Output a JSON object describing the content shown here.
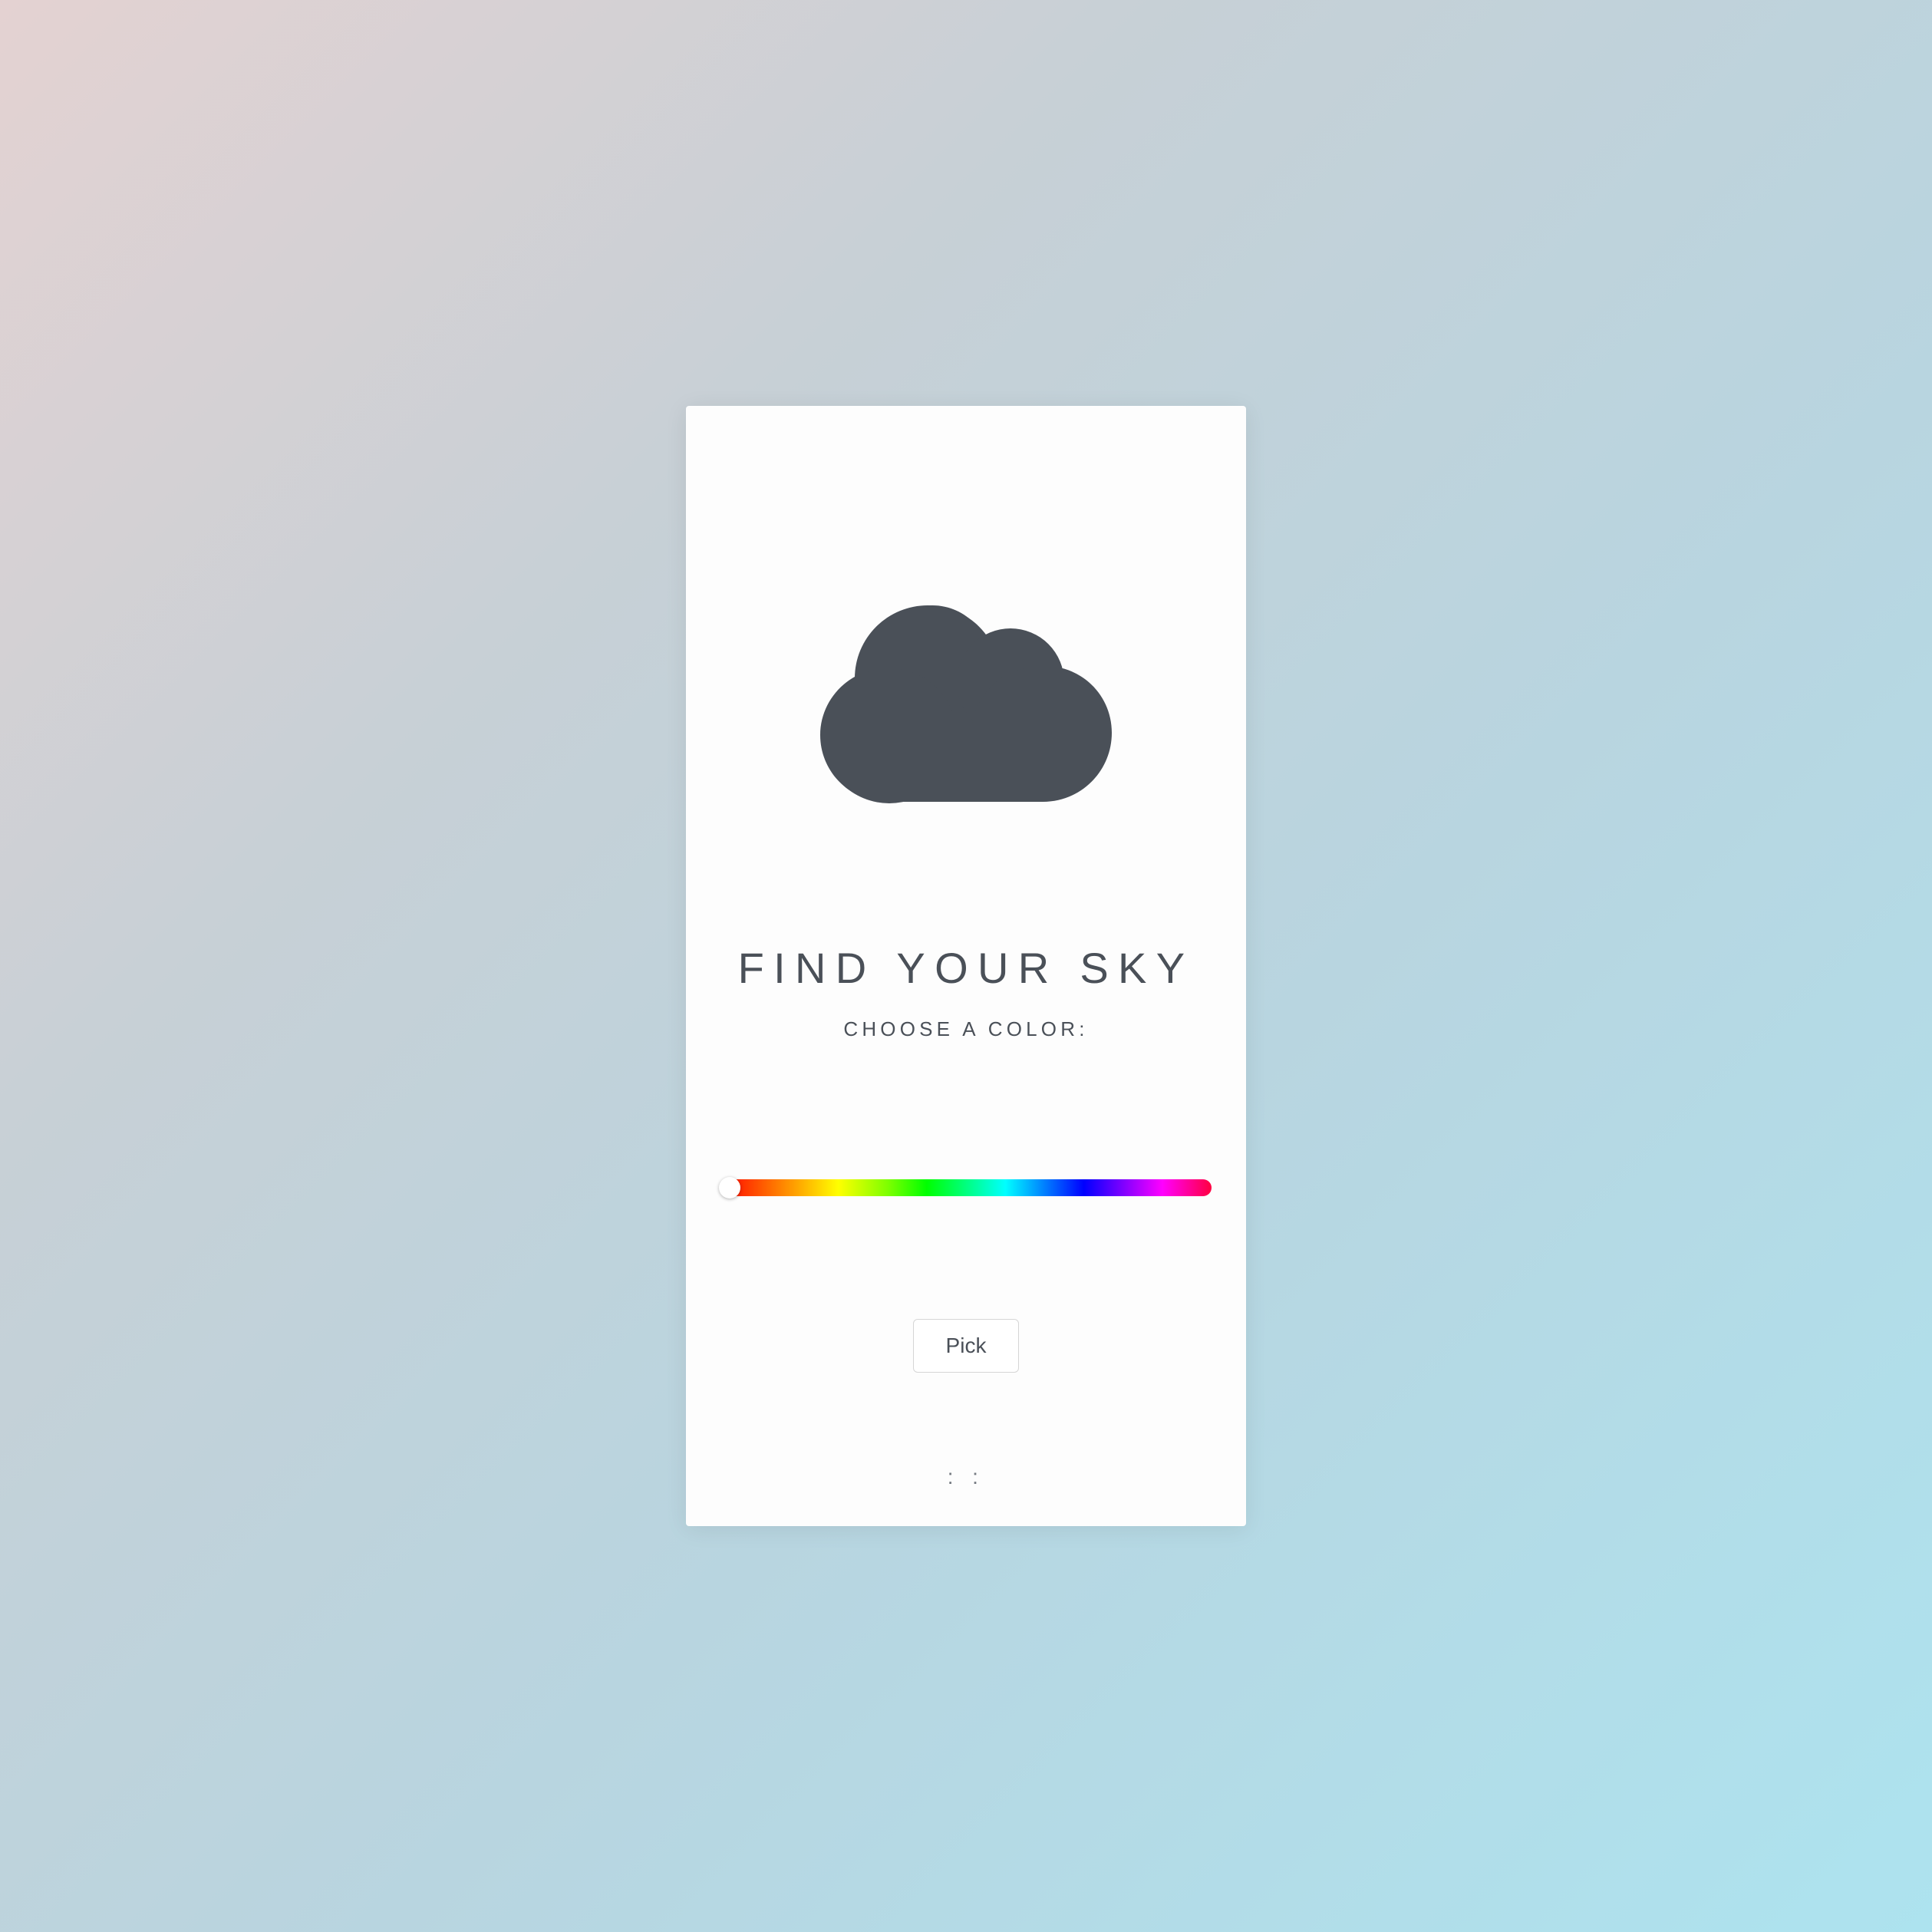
{
  "card": {
    "title": "FIND YOUR SKY",
    "subtitle": "CHOOSE A COLOR:",
    "pick_button_label": "Pick",
    "footer_marker": ": :"
  },
  "slider": {
    "value": 0,
    "min": 0,
    "max": 360
  },
  "colors": {
    "text": "#4a5058",
    "card_bg": "#fdfdfd",
    "cloud": "#4a5058"
  }
}
